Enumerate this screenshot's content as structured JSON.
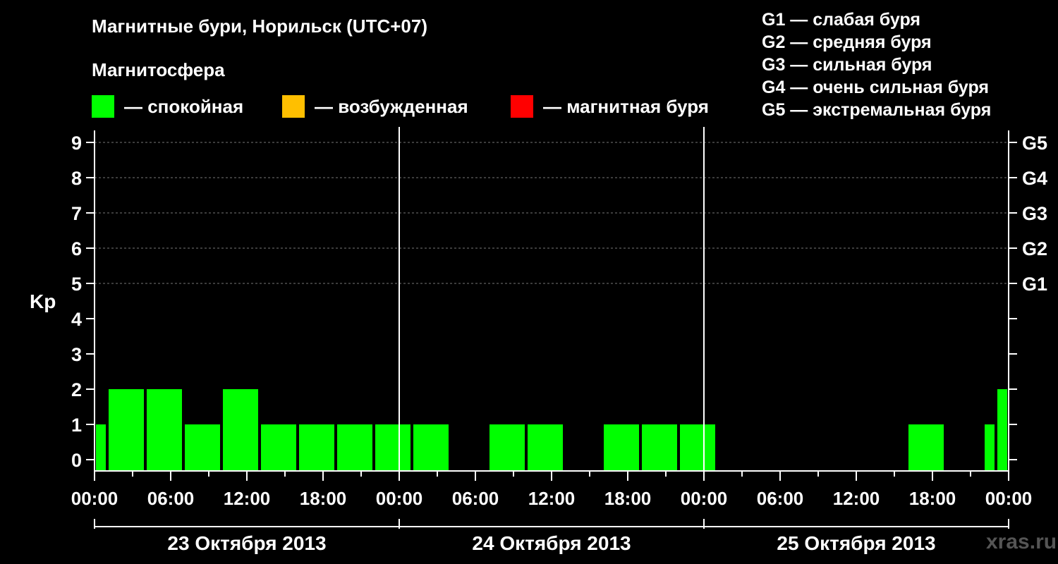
{
  "title": "Магнитные бури, Норильск (UTC+07)",
  "subtitle": "Магнитосфера",
  "legend": [
    {
      "label": "— спокойная",
      "color": "#00ff00"
    },
    {
      "label": "— возбужденная",
      "color": "#ffbf00"
    },
    {
      "label": "— магнитная буря",
      "color": "#ff0000"
    }
  ],
  "storm_levels": [
    "G1 — слабая буря",
    "G2 — средняя буря",
    "G3 — сильная буря",
    "G4 — очень сильная буря",
    "G5 — экстремальная буря"
  ],
  "watermark": "xras.ru",
  "chart_data": {
    "type": "bar",
    "title": "Магнитные бури, Норильск (UTC+07)",
    "ylabel": "Kp",
    "ylim": [
      0,
      9
    ],
    "yticks": [
      "0",
      "1",
      "2",
      "3",
      "4",
      "5",
      "6",
      "7",
      "8",
      "9"
    ],
    "right_ticks": [
      {
        "value": 5,
        "label": "G1"
      },
      {
        "value": 6,
        "label": "G2"
      },
      {
        "value": 7,
        "label": "G3"
      },
      {
        "value": 8,
        "label": "G4"
      },
      {
        "value": 9,
        "label": "G5"
      }
    ],
    "xticks": [
      "00:00",
      "06:00",
      "12:00",
      "18:00",
      "00:00",
      "06:00",
      "12:00",
      "18:00",
      "00:00",
      "06:00",
      "12:00",
      "18:00",
      "00:00"
    ],
    "days": [
      "23 Октября 2013",
      "24 Октября 2013",
      "25 Октября 2013"
    ],
    "bar_start_hours": [
      0,
      1,
      4,
      7,
      10,
      13,
      16,
      19,
      22,
      25,
      28,
      31,
      34,
      37,
      40,
      43,
      46,
      49,
      52,
      55,
      58,
      61,
      64,
      67,
      70,
      71
    ],
    "bar_end_hours": [
      1,
      4,
      7,
      10,
      13,
      16,
      19,
      22,
      25,
      28,
      31,
      34,
      37,
      40,
      43,
      46,
      49,
      52,
      55,
      58,
      61,
      64,
      67,
      70,
      71,
      72
    ],
    "values": [
      1,
      2,
      2,
      1,
      2,
      1,
      1,
      1,
      1,
      1,
      0,
      1,
      1,
      0,
      1,
      1,
      1,
      0,
      0,
      0,
      0,
      0,
      1,
      0,
      1,
      2
    ],
    "bar_colors": [
      "#00ff00",
      "#00ff00",
      "#00ff00",
      "#00ff00",
      "#00ff00",
      "#00ff00",
      "#00ff00",
      "#00ff00",
      "#00ff00",
      "#00ff00",
      "#00ff00",
      "#00ff00",
      "#00ff00",
      "#00ff00",
      "#00ff00",
      "#00ff00",
      "#00ff00",
      "#00ff00",
      "#00ff00",
      "#00ff00",
      "#00ff00",
      "#00ff00",
      "#00ff00",
      "#00ff00",
      "#00ff00",
      "#00ff00"
    ]
  }
}
